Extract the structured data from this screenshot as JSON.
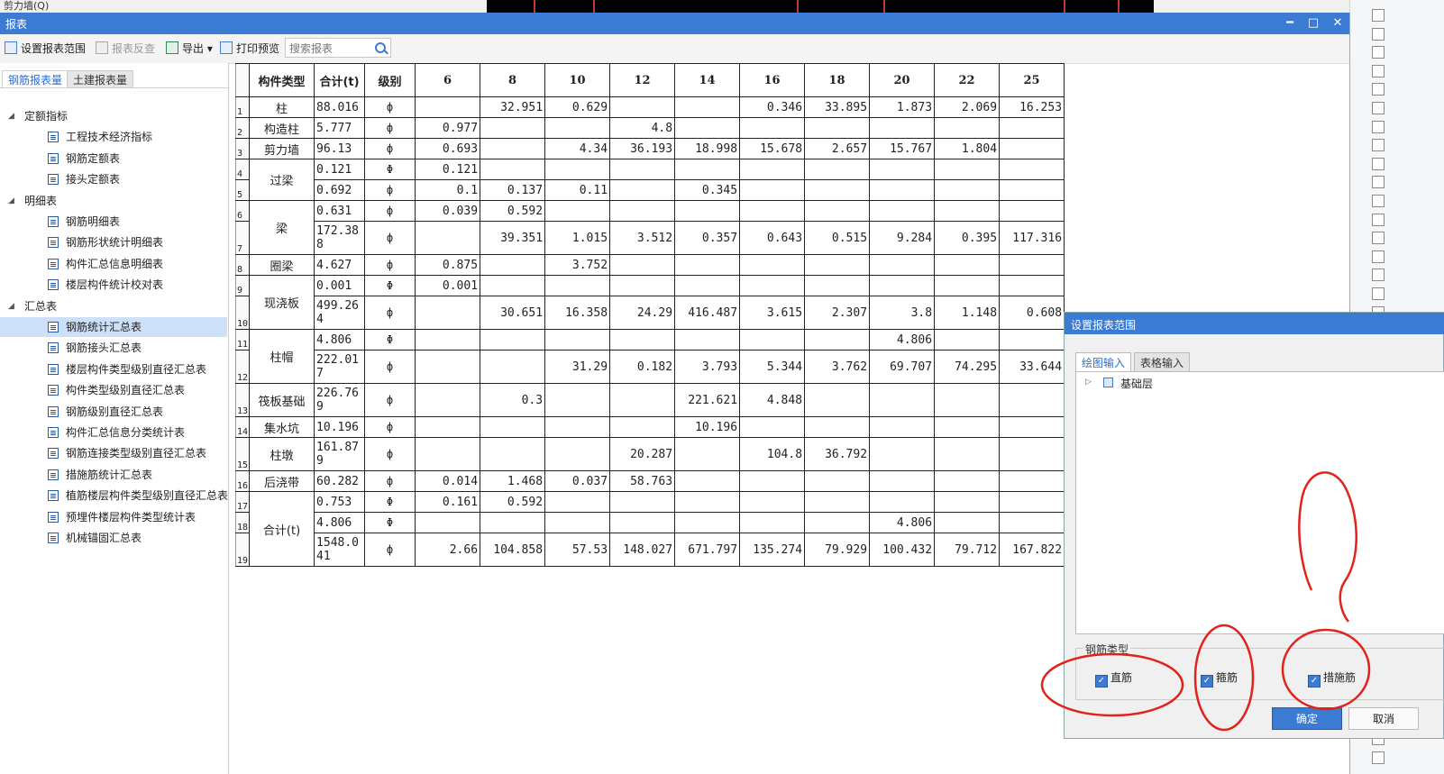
{
  "background": {
    "top_left_text": "剪力墙(Q)"
  },
  "window": {
    "title": "报表",
    "minimize": "━",
    "maximize": "□",
    "close": "✕"
  },
  "toolbar": {
    "set_range": "设置报表范围",
    "reverse_lookup": "报表反查",
    "export": "导出",
    "print_preview": "打印预览",
    "search_placeholder": "搜索报表"
  },
  "left_tabs": {
    "rebar": "钢筋报表量",
    "civil": "土建报表量"
  },
  "tree": {
    "groups": [
      {
        "label": "定额指标",
        "items": [
          "工程技术经济指标",
          "钢筋定额表",
          "接头定额表"
        ]
      },
      {
        "label": "明细表",
        "items": [
          "钢筋明细表",
          "钢筋形状统计明细表",
          "构件汇总信息明细表",
          "楼层构件统计校对表"
        ]
      },
      {
        "label": "汇总表",
        "items": [
          "钢筋统计汇总表",
          "钢筋接头汇总表",
          "楼层构件类型级别直径汇总表",
          "构件类型级别直径汇总表",
          "钢筋级别直径汇总表",
          "构件汇总信息分类统计表",
          "钢筋连接类型级别直径汇总表",
          "措施筋统计汇总表",
          "植筋楼层构件类型级别直径汇总表",
          "预埋件楼层构件类型统计表",
          "机械锚固汇总表"
        ]
      }
    ],
    "selected": "钢筋统计汇总表"
  },
  "table": {
    "headers": [
      "构件类型",
      "合计(t)",
      "级别",
      "6",
      "8",
      "10",
      "12",
      "14",
      "16",
      "18",
      "20",
      "22",
      "25"
    ],
    "rows": [
      {
        "n": "1",
        "type": "柱",
        "total": "88.016",
        "grade": "ф",
        "v": [
          "",
          "32.951",
          "0.629",
          "",
          "",
          "0.346",
          "33.895",
          "1.873",
          "2.069",
          "16.253"
        ]
      },
      {
        "n": "2",
        "type": "构造柱",
        "total": "5.777",
        "grade": "ф",
        "v": [
          "0.977",
          "",
          "",
          "4.8",
          "",
          "",
          "",
          "",
          "",
          ""
        ]
      },
      {
        "n": "3",
        "type": "剪力墙",
        "total": "96.13",
        "grade": "ф",
        "v": [
          "0.693",
          "",
          "4.34",
          "36.193",
          "18.998",
          "15.678",
          "2.657",
          "15.767",
          "1.804",
          ""
        ]
      },
      {
        "n": "4",
        "type": "过梁",
        "total": "0.121",
        "grade": "Φ",
        "v": [
          "0.121",
          "",
          "",
          "",
          "",
          "",
          "",
          "",
          "",
          ""
        ]
      },
      {
        "n": "5",
        "type": "",
        "total": "0.692",
        "grade": "ф",
        "v": [
          "0.1",
          "0.137",
          "0.11",
          "",
          "0.345",
          "",
          "",
          "",
          "",
          ""
        ]
      },
      {
        "n": "6",
        "type": "梁",
        "total": "0.631",
        "grade": "ф",
        "v": [
          "0.039",
          "0.592",
          "",
          "",
          "",
          "",
          "",
          "",
          "",
          ""
        ]
      },
      {
        "n": "7",
        "type": "",
        "total": "172.388",
        "grade": "ф",
        "v": [
          "",
          "39.351",
          "1.015",
          "3.512",
          "0.357",
          "0.643",
          "0.515",
          "9.284",
          "0.395",
          "117.316"
        ]
      },
      {
        "n": "8",
        "type": "圈梁",
        "total": "4.627",
        "grade": "ф",
        "v": [
          "0.875",
          "",
          "3.752",
          "",
          "",
          "",
          "",
          "",
          "",
          ""
        ]
      },
      {
        "n": "9",
        "type": "现浇板",
        "total": "0.001",
        "grade": "Φ",
        "v": [
          "0.001",
          "",
          "",
          "",
          "",
          "",
          "",
          "",
          "",
          ""
        ]
      },
      {
        "n": "10",
        "type": "",
        "total": "499.264",
        "grade": "ф",
        "v": [
          "",
          "30.651",
          "16.358",
          "24.29",
          "416.487",
          "3.615",
          "2.307",
          "3.8",
          "1.148",
          "0.608"
        ]
      },
      {
        "n": "11",
        "type": "柱帽",
        "total": "4.806",
        "grade": "Φ",
        "v": [
          "",
          "",
          "",
          "",
          "",
          "",
          "",
          "4.806",
          "",
          ""
        ]
      },
      {
        "n": "12",
        "type": "",
        "total": "222.017",
        "grade": "ф",
        "v": [
          "",
          "",
          "31.29",
          "0.182",
          "3.793",
          "5.344",
          "3.762",
          "69.707",
          "74.295",
          "33.644"
        ]
      },
      {
        "n": "13",
        "type": "筏板基础",
        "total": "226.769",
        "grade": "ф",
        "v": [
          "",
          "0.3",
          "",
          "",
          "221.621",
          "4.848",
          "",
          "",
          "",
          ""
        ]
      },
      {
        "n": "14",
        "type": "集水坑",
        "total": "10.196",
        "grade": "ф",
        "v": [
          "",
          "",
          "",
          "",
          "10.196",
          "",
          "",
          "",
          "",
          ""
        ]
      },
      {
        "n": "15",
        "type": "柱墩",
        "total": "161.879",
        "grade": "ф",
        "v": [
          "",
          "",
          "",
          "20.287",
          "",
          "104.8",
          "36.792",
          "",
          "",
          ""
        ]
      },
      {
        "n": "16",
        "type": "后浇带",
        "total": "60.282",
        "grade": "ф",
        "v": [
          "0.014",
          "1.468",
          "0.037",
          "58.763",
          "",
          "",
          "",
          "",
          "",
          ""
        ]
      },
      {
        "n": "17",
        "type": "合计(t)",
        "total": "0.753",
        "grade": "Φ",
        "v": [
          "0.161",
          "0.592",
          "",
          "",
          "",
          "",
          "",
          "",
          "",
          ""
        ]
      },
      {
        "n": "18",
        "type": "",
        "total": "4.806",
        "grade": "Φ",
        "v": [
          "",
          "",
          "",
          "",
          "",
          "",
          "",
          "4.806",
          "",
          ""
        ]
      },
      {
        "n": "19",
        "type": "",
        "total": "1548.041",
        "grade": "ф",
        "v": [
          "2.66",
          "104.858",
          "57.53",
          "148.027",
          "671.797",
          "135.274",
          "79.929",
          "100.432",
          "79.712",
          "167.822"
        ]
      }
    ]
  },
  "dialog": {
    "title": "设置报表范围",
    "tab_drawing": "绘图输入",
    "tab_table": "表格输入",
    "tree_item": "基础层",
    "group_label": "钢筋类型",
    "chk_straight": "直筋",
    "chk_stirrup": "箍筋",
    "chk_measure": "措施筋",
    "ok": "确定",
    "cancel": "取消"
  }
}
